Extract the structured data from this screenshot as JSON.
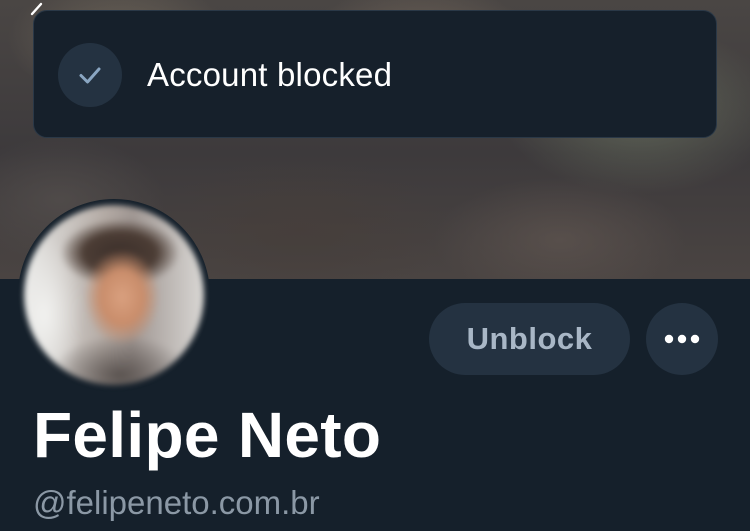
{
  "toast": {
    "message": "Account blocked",
    "icon": "check-icon"
  },
  "profile": {
    "display_name": "Felipe Neto",
    "handle": "@felipeneto.com.br"
  },
  "actions": {
    "unblock_label": "Unblock",
    "more_icon": "more-dots-icon"
  },
  "colors": {
    "background": "#15202b",
    "toast_background": "#16202b",
    "button_background": "#243241",
    "button_text": "#a9b7c6",
    "secondary_text": "#8b98a5",
    "primary_text": "#ffffff"
  }
}
